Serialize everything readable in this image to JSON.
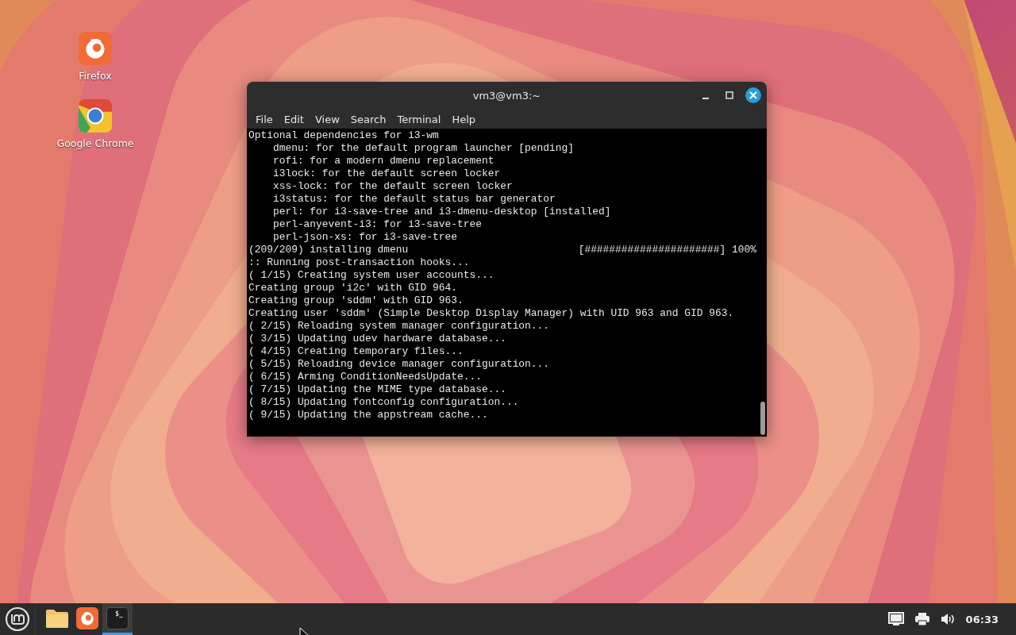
{
  "desktop_icons": [
    {
      "kind": "firefox",
      "label": "Firefox"
    },
    {
      "kind": "chrome",
      "label": "Google Chrome"
    }
  ],
  "window": {
    "title": "vm3@vm3:~",
    "menu": [
      "File",
      "Edit",
      "View",
      "Search",
      "Terminal",
      "Help"
    ],
    "lines": [
      {
        "kind": "plain",
        "text": "Optional dependencies for i3-wm"
      },
      {
        "kind": "plain",
        "text": "    dmenu: for the default program launcher [pending]"
      },
      {
        "kind": "plain",
        "text": "    rofi: for a modern dmenu replacement"
      },
      {
        "kind": "plain",
        "text": "    i3lock: for the default screen locker"
      },
      {
        "kind": "plain",
        "text": "    xss-lock: for the default screen locker"
      },
      {
        "kind": "plain",
        "text": "    i3status: for the default status bar generator"
      },
      {
        "kind": "plain",
        "text": "    perl: for i3-save-tree and i3-dmenu-desktop [installed]"
      },
      {
        "kind": "plain",
        "text": "    perl-anyevent-i3: for i3-save-tree"
      },
      {
        "kind": "plain",
        "text": "    perl-json-xs: for i3-save-tree"
      },
      {
        "kind": "progress",
        "text": "(209/209) installing dmenu",
        "right": "[######################] 100%"
      },
      {
        "kind": "plain",
        "text": ":: Running post-transaction hooks..."
      },
      {
        "kind": "plain",
        "text": "( 1/15) Creating system user accounts..."
      },
      {
        "kind": "plain",
        "text": "Creating group 'i2c' with GID 964."
      },
      {
        "kind": "plain",
        "text": "Creating group 'sddm' with GID 963."
      },
      {
        "kind": "plain",
        "text": "Creating user 'sddm' (Simple Desktop Display Manager) with UID 963 and GID 963."
      },
      {
        "kind": "plain",
        "text": "( 2/15) Reloading system manager configuration..."
      },
      {
        "kind": "plain",
        "text": "( 3/15) Updating udev hardware database..."
      },
      {
        "kind": "plain",
        "text": "( 4/15) Creating temporary files..."
      },
      {
        "kind": "plain",
        "text": "( 5/15) Reloading device manager configuration..."
      },
      {
        "kind": "plain",
        "text": "( 6/15) Arming ConditionNeedsUpdate..."
      },
      {
        "kind": "plain",
        "text": "( 7/15) Updating the MIME type database..."
      },
      {
        "kind": "plain",
        "text": "( 8/15) Updating fontconfig configuration..."
      },
      {
        "kind": "plain",
        "text": "( 9/15) Updating the appstream cache..."
      }
    ]
  },
  "taskbar": {
    "launchers": [
      {
        "kind": "files",
        "active": false
      },
      {
        "kind": "firefox",
        "active": false
      },
      {
        "kind": "terminal",
        "glyph": "$_",
        "active": true
      }
    ],
    "clock": "06:33"
  }
}
